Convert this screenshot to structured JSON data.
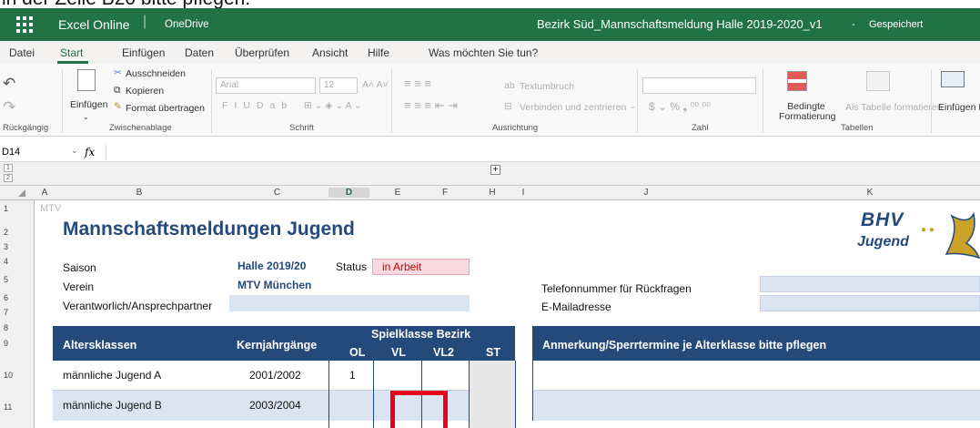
{
  "top_text": "in der Zeile B20 bitte pflegen.",
  "titlebar": {
    "app": "Excel Online",
    "location": "OneDrive",
    "file": "Bezirk Süd_Mannschaftsmeldung Halle 2019-2020_v1",
    "dash": "-",
    "save_status": "Gespeichert"
  },
  "menu": [
    "Datei",
    "Start",
    "Einfügen",
    "Daten",
    "Überprüfen",
    "Ansicht",
    "Hilfe",
    "Was möchten Sie tun?"
  ],
  "ribbon": {
    "undo_group": "Rückgängig",
    "paste": "Einfügen",
    "cut": "Ausschneiden",
    "copy": "Kopieren",
    "format_painter": "Format übertragen",
    "clipboard_group": "Zwischenablage",
    "font_name": "Arial",
    "font_size": "12",
    "font_group": "Schrift",
    "wrap": "Textumbruch",
    "merge": "Verbinden und zentrieren",
    "align_group": "Ausrichtung",
    "number_group": "Zahl",
    "cond_format": "Bedingte Formatierung",
    "table_format": "Als Tabelle formatieren",
    "tables_group": "Tabellen",
    "insert": "Einfügen L"
  },
  "namebox": "D14",
  "fx": "fx",
  "columns": [
    "A",
    "B",
    "C",
    "D",
    "E",
    "F",
    "H",
    "I",
    "J",
    "K"
  ],
  "rows": [
    "1",
    "2",
    "3",
    "4",
    "5",
    "6",
    "7",
    "8",
    "9",
    "10",
    "11"
  ],
  "sheet": {
    "a1": "MTV",
    "title": "Mannschaftsmeldungen Jugend",
    "saison_label": "Saison",
    "saison_value": "Halle 2019/20",
    "status_label": "Status",
    "status_value": "in Arbeit",
    "verein_label": "Verein",
    "verein_value": "MTV München",
    "contact_label": "Verantworlich/Ansprechpartner",
    "phone_label": "Telefonnummer für Rückfragen",
    "email_label": "E-Mailadresse",
    "logo_top": "BHV",
    "logo_bottom": "Jugend",
    "hdr_age": "Altersklassen",
    "hdr_years": "Kernjahrgänge",
    "hdr_league": "Spielklasse Bezirk",
    "hdr_ol": "OL",
    "hdr_vl": "VL",
    "hdr_vl2": "VL2",
    "hdr_st": "ST",
    "hdr_notes": "Anmerkung/Sperrtermine je Alterklasse bitte pflegen",
    "rows": [
      {
        "age": "männliche Jugend A",
        "years": "2001/2002",
        "ol": "1"
      },
      {
        "age": "männliche Jugend B",
        "years": "2003/2004",
        "ol": ""
      }
    ]
  },
  "colors": {
    "excel_green": "#217346",
    "header_blue": "#24497b",
    "band": "#dbe5f1",
    "status_pink": "#f9d9df",
    "highlight_red": "#e8001c"
  }
}
